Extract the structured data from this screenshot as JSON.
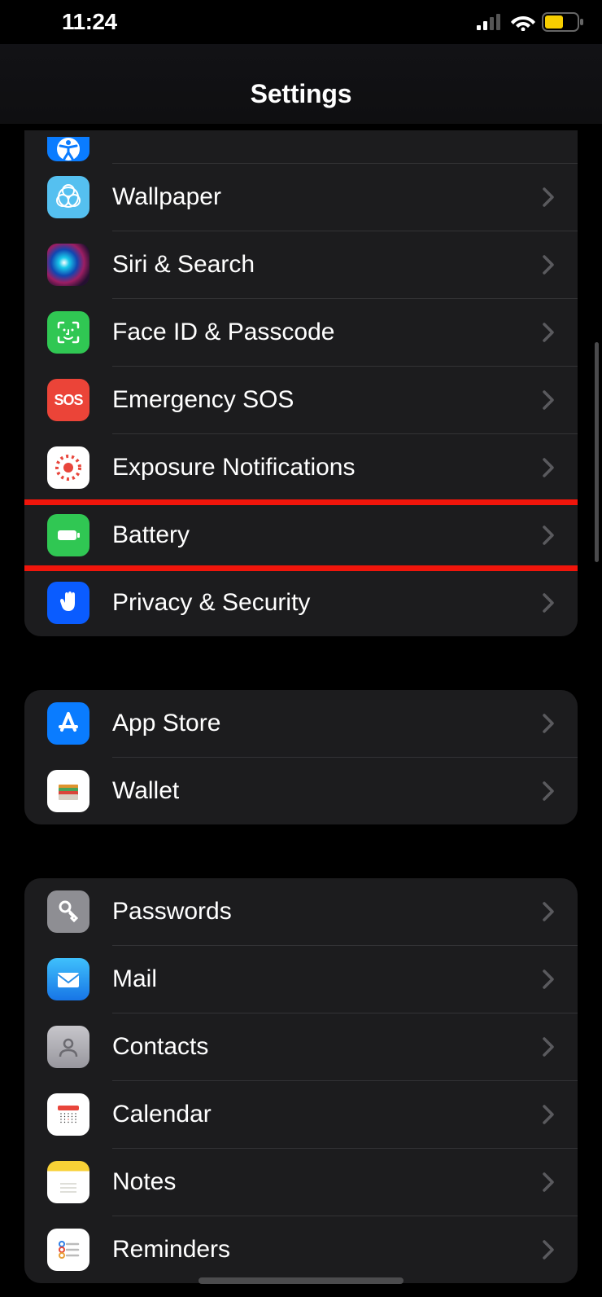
{
  "status": {
    "time": "11:24"
  },
  "header": {
    "title": "Settings"
  },
  "groups": [
    {
      "id": "general",
      "first": true,
      "highlightIndex": 6,
      "rows": [
        {
          "name": "accessibility",
          "label": "Accessibility",
          "icon": "accessibility",
          "bg": "blue",
          "cut": true
        },
        {
          "name": "wallpaper",
          "label": "Wallpaper",
          "icon": "wallpaper",
          "bg": "cyan"
        },
        {
          "name": "siri-search",
          "label": "Siri & Search",
          "icon": "siri",
          "bg": "siri"
        },
        {
          "name": "face-id-passcode",
          "label": "Face ID & Passcode",
          "icon": "faceid",
          "bg": "green"
        },
        {
          "name": "emergency-sos",
          "label": "Emergency SOS",
          "icon": "sos",
          "bg": "red"
        },
        {
          "name": "exposure-notifications",
          "label": "Exposure Notifications",
          "icon": "exposure",
          "bg": "white"
        },
        {
          "name": "battery",
          "label": "Battery",
          "icon": "battery",
          "bg": "green"
        },
        {
          "name": "privacy-security",
          "label": "Privacy & Security",
          "icon": "hand",
          "bg": "hand"
        }
      ]
    },
    {
      "id": "store",
      "rows": [
        {
          "name": "app-store",
          "label": "App Store",
          "icon": "appstore",
          "bg": "blue"
        },
        {
          "name": "wallet",
          "label": "Wallet",
          "icon": "wallet",
          "bg": "white"
        }
      ]
    },
    {
      "id": "apps",
      "rows": [
        {
          "name": "passwords",
          "label": "Passwords",
          "icon": "key",
          "bg": "grey"
        },
        {
          "name": "mail",
          "label": "Mail",
          "icon": "mail",
          "bg": "mail"
        },
        {
          "name": "contacts",
          "label": "Contacts",
          "icon": "contacts",
          "bg": "contacts"
        },
        {
          "name": "calendar",
          "label": "Calendar",
          "icon": "calendar",
          "bg": "white"
        },
        {
          "name": "notes",
          "label": "Notes",
          "icon": "notes",
          "bg": "notes"
        },
        {
          "name": "reminders",
          "label": "Reminders",
          "icon": "reminders",
          "bg": "white"
        }
      ]
    }
  ]
}
